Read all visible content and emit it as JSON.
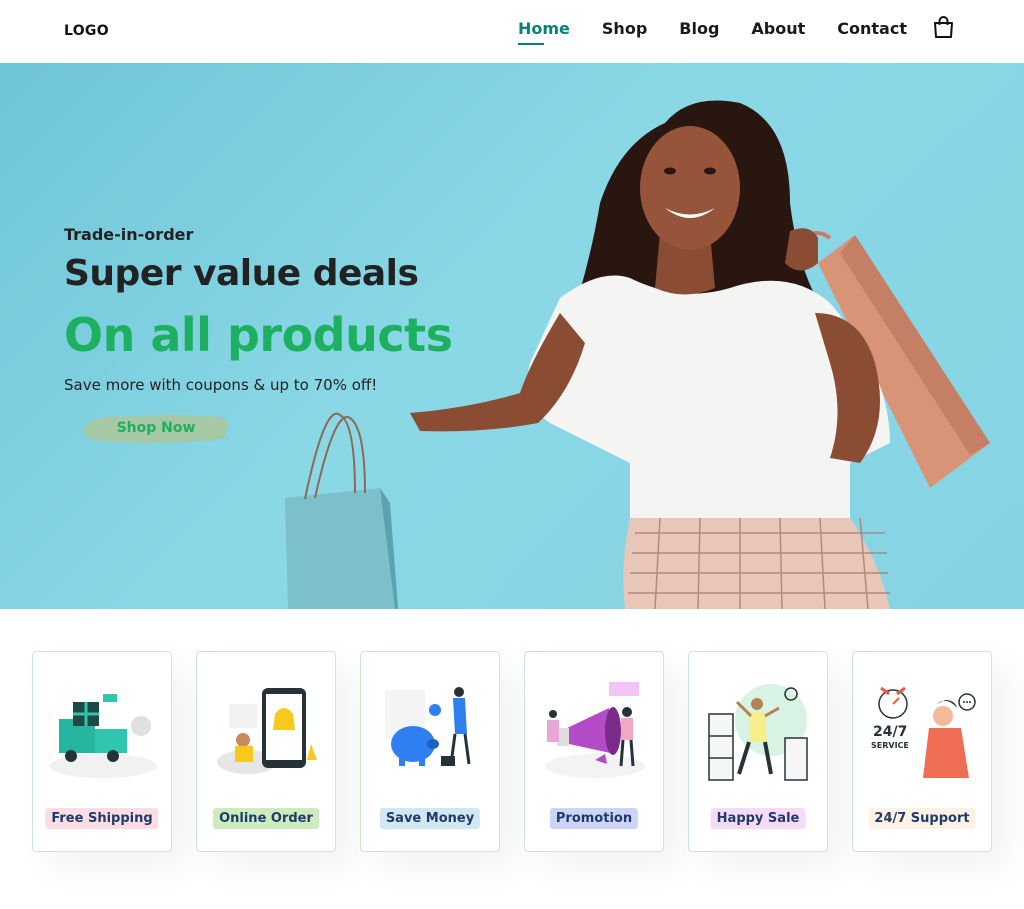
{
  "header": {
    "logo_text": "LOGO",
    "nav": [
      {
        "label": "Home",
        "active": true
      },
      {
        "label": "Shop",
        "active": false
      },
      {
        "label": "Blog",
        "active": false
      },
      {
        "label": "About",
        "active": false
      },
      {
        "label": "Contact",
        "active": false
      }
    ],
    "cart_icon": "shopping-bag-icon"
  },
  "hero": {
    "subtitle": "Trade-in-order",
    "title_line1": "Super value deals",
    "title_line2": "On all products",
    "description": "Save more with coupons & up to 70% off!",
    "button_label": "Shop Now"
  },
  "features": [
    {
      "label": "Free Shipping",
      "bg": "#fddde4",
      "color": "#1f3b6b",
      "illustration": "delivery-truck-illustration"
    },
    {
      "label": "Online Order",
      "bg": "#cdebbc",
      "color": "#1f3b6b",
      "illustration": "online-order-phone-illustration"
    },
    {
      "label": "Save Money",
      "bg": "#d1e8f2",
      "color": "#1f3b6b",
      "illustration": "piggy-bank-illustration"
    },
    {
      "label": "Promotion",
      "bg": "#cdd4f8",
      "color": "#1f3b6b",
      "illustration": "megaphone-promotion-illustration"
    },
    {
      "label": "Happy Sale",
      "bg": "#f6dbf6",
      "color": "#1f3b6b",
      "illustration": "happy-dance-illustration"
    },
    {
      "label": "24/7 Support",
      "bg": "#fff2e5",
      "color": "#1f3b6b",
      "illustration": "support-agent-illustration"
    }
  ],
  "colors": {
    "accent_green": "#088178",
    "hero_green": "#1cb060",
    "hero_bg": "#86d4e3"
  }
}
